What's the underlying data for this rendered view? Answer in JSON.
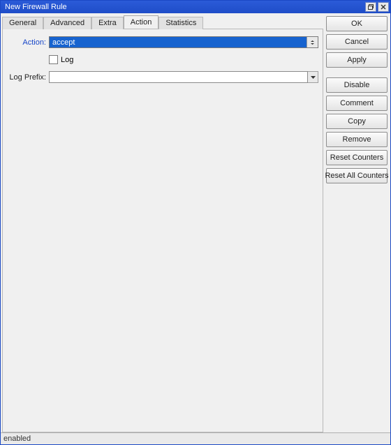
{
  "window": {
    "title": "New Firewall Rule"
  },
  "tabs": {
    "items": [
      "General",
      "Advanced",
      "Extra",
      "Action",
      "Statistics"
    ],
    "active_index": 3
  },
  "form": {
    "action_label": "Action:",
    "action_value": "accept",
    "log_label": "Log",
    "log_checked": false,
    "log_prefix_label": "Log Prefix:",
    "log_prefix_value": ""
  },
  "buttons": {
    "ok": "OK",
    "cancel": "Cancel",
    "apply": "Apply",
    "disable": "Disable",
    "comment": "Comment",
    "copy": "Copy",
    "remove": "Remove",
    "reset_counters": "Reset Counters",
    "reset_all_counters": "Reset All Counters"
  },
  "status": {
    "text": "enabled"
  }
}
